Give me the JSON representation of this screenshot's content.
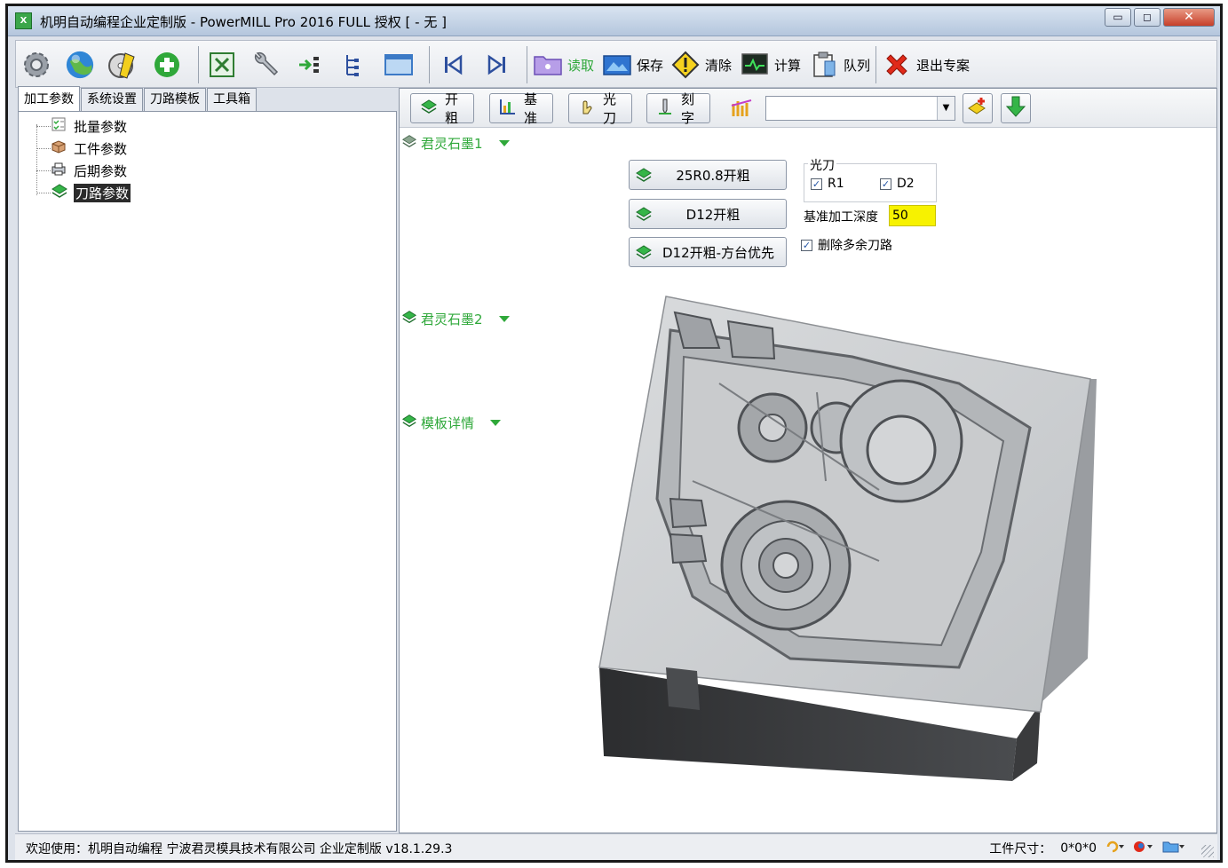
{
  "window": {
    "title": "机明自动编程企业定制版 - PowerMILL Pro 2016 FULL 授权   [ - 无 ]",
    "app_icon_text": "X",
    "controls": {
      "minimize": "▭",
      "maximize": "◻",
      "close": "✕"
    }
  },
  "toolbar": {
    "icons": [
      {
        "name": "settings-gear-icon"
      },
      {
        "name": "globe-icon"
      },
      {
        "name": "cd-tools-icon"
      },
      {
        "name": "add-plus-icon"
      },
      {
        "name": "excel-icon"
      },
      {
        "name": "wrench-icon"
      },
      {
        "name": "insert-arrow-icon"
      },
      {
        "name": "tree-structure-icon"
      },
      {
        "name": "folder-panel-icon"
      },
      {
        "name": "skip-first-icon"
      },
      {
        "name": "skip-last-icon"
      }
    ],
    "read_label": "读取",
    "save_label": "保存",
    "clear_label": "清除",
    "calc_label": "计算",
    "queue_label": "队列",
    "exit_label": "退出专案"
  },
  "left_panel": {
    "tabs": [
      "加工参数",
      "系统设置",
      "刀路模板",
      "工具箱"
    ],
    "active_tab": 0,
    "tree": [
      {
        "label": "批量参数"
      },
      {
        "label": "工件参数"
      },
      {
        "label": "后期参数"
      },
      {
        "label": "刀路参数",
        "selected": true
      }
    ]
  },
  "right_panel": {
    "toolbar": {
      "rough_label": "开粗",
      "datum_label": "基准",
      "finish_label": "光刀",
      "engrave_label": "刻字",
      "combo_value": ""
    },
    "sections": [
      {
        "label": "君灵石墨1"
      },
      {
        "label": "君灵石墨2"
      },
      {
        "label": "模板详情"
      }
    ],
    "operations": [
      "25R0.8开粗",
      "D12开粗",
      "D12开粗-方台优先"
    ],
    "finish_group": {
      "title": "光刀",
      "options": [
        {
          "label": "R1",
          "checked": true
        },
        {
          "label": "D2",
          "checked": true
        }
      ]
    },
    "depth_label": "基准加工深度",
    "depth_value": "50",
    "delete_extra": {
      "label": "删除多余刀路",
      "checked": true
    }
  },
  "statusbar": {
    "text": "欢迎使用：机明自动编程 宁波君灵模具技术有限公司 企业定制版 v18.1.29.3",
    "size_label": "工件尺寸：",
    "size_value": "0*0*0"
  },
  "colors": {
    "accent_green": "#2fa83a",
    "depth_highlight": "#f7f200",
    "close_red": "#c6402a"
  }
}
